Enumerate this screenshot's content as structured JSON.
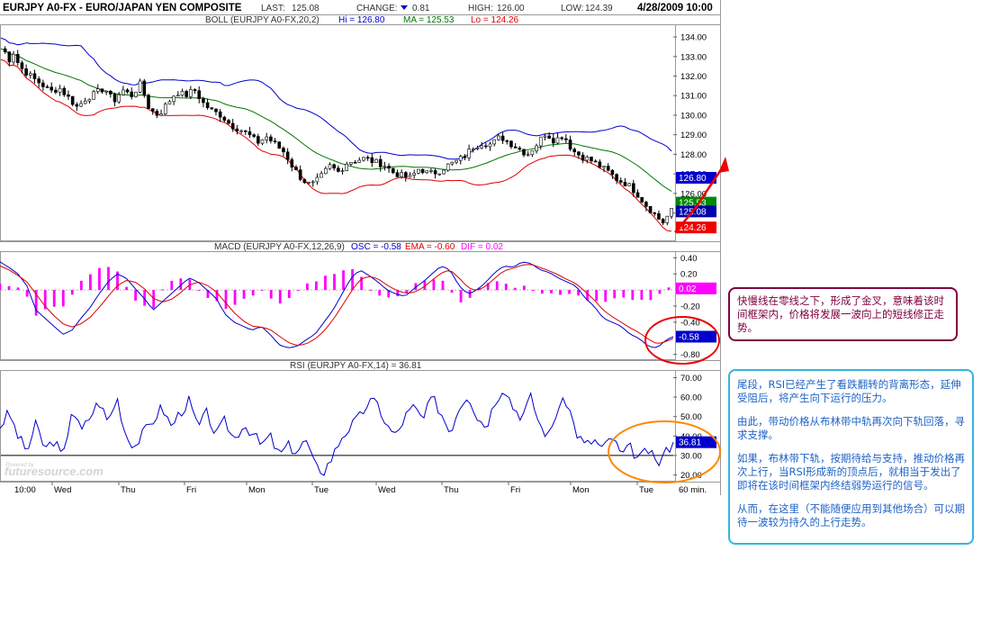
{
  "header": {
    "symbol": "EURJPY A0-FX - EURO/JAPAN YEN COMPOSITE",
    "last_label": "LAST:",
    "last_value": "125.08",
    "change_label": "CHANGE:",
    "change_value": "0.81",
    "high_label": "HIGH:",
    "high_value": "126.00",
    "low_label": "LOW:",
    "low_value": "124.39",
    "date_time": "4/28/2009 10:00"
  },
  "boll_legend": {
    "name": "BOLL (EURJPY A0-FX,20,2)",
    "hi": "Hi = 126.80",
    "ma": "MA = 125.53",
    "lo": "Lo = 124.26"
  },
  "macd_legend": {
    "name": "MACD (EURJPY A0-FX,12,26,9)",
    "osc": "OSC = -0.58",
    "ema": "EMA = -0.60",
    "dif": "DIF = 0.02"
  },
  "rsi_legend": {
    "name": "RSI (EURJPY A0-FX,14) = 36.81"
  },
  "watermark": "futuresource.com",
  "watermark_small": "Powered by",
  "colors": {
    "upper_band": "#0000cc",
    "middle_band": "#007700",
    "lower_band": "#dd0000",
    "macd_line": "#0000cc",
    "signal_line": "#dd0000",
    "histogram": "#ff00ff",
    "rsi_line": "#0000cc",
    "annotation_red": "#ee0000",
    "annotation_orange": "#ff8800",
    "callout_macd_border": "#800040",
    "callout_rsi_border": "#35b4e0",
    "callout_rsi_text": "#1f63c6"
  },
  "chart_data": [
    {
      "type": "line",
      "panel": "price",
      "ylim": [
        123.6,
        134.6
      ],
      "yticks": [
        "134.00",
        "133.00",
        "132.00",
        "131.00",
        "130.00",
        "129.00",
        "128.00",
        "127.00",
        "126.00",
        "125.00"
      ],
      "x_tick_labels": [
        "10:00",
        "Wed",
        "Thu",
        "Fri",
        "Mon",
        "Tue",
        "Wed",
        "Thu",
        "Fri",
        "Mon",
        "Tue",
        "60 min."
      ],
      "price_path_x": [
        0,
        5,
        10,
        15,
        20,
        28,
        35,
        45,
        55,
        65,
        75,
        85,
        95,
        105,
        115,
        125,
        135,
        145,
        155,
        165,
        175,
        185,
        195,
        205,
        215,
        225,
        235,
        245,
        255,
        265,
        275,
        285,
        295,
        305,
        315,
        325,
        335,
        345,
        355,
        365,
        375,
        385,
        395,
        405,
        415,
        425,
        435,
        445,
        455,
        465,
        475,
        485,
        495,
        505,
        515,
        525,
        535,
        545,
        555,
        565,
        575,
        585,
        595,
        605,
        615,
        625,
        635,
        645,
        655,
        665,
        675,
        685,
        695,
        705,
        715,
        725,
        735,
        745
      ],
      "price_path": [
        133.4,
        133.2,
        132.8,
        133.3,
        132.5,
        132.2,
        131.9,
        131.6,
        131.2,
        131.4,
        130.9,
        130.4,
        130.9,
        131.1,
        131.4,
        130.7,
        131.3,
        131.0,
        131.6,
        130.3,
        130.0,
        130.6,
        131.2,
        131.0,
        131.3,
        130.6,
        130.2,
        130.0,
        129.5,
        129.3,
        129.0,
        128.6,
        128.9,
        128.5,
        128.1,
        127.3,
        126.7,
        126.4,
        126.8,
        127.4,
        127.1,
        127.6,
        127.7,
        127.8,
        127.6,
        127.5,
        127.1,
        126.9,
        126.8,
        127.3,
        127.0,
        127.1,
        127.4,
        127.6,
        127.9,
        128.4,
        128.6,
        128.5,
        128.9,
        128.6,
        128.3,
        128.0,
        128.5,
        129.1,
        128.7,
        129.0,
        128.2,
        127.9,
        127.7,
        127.4,
        127.1,
        126.7,
        126.5,
        126.1,
        125.5,
        125.0,
        124.5,
        125.1
      ],
      "series": [
        {
          "name": "Hi",
          "last": 126.8
        },
        {
          "name": "MA",
          "last": 125.53
        },
        {
          "name": "Lo",
          "last": 124.26
        }
      ],
      "value_tags": [
        {
          "label": "126.80",
          "value": 126.8,
          "color": "#0000cc"
        },
        {
          "label": "125.53",
          "value": 125.53,
          "color": "#008800"
        },
        {
          "label": "125.08",
          "value": 125.08,
          "color": "#0000aa"
        },
        {
          "label": "124.26",
          "value": 124.26,
          "color": "#ee0000"
        }
      ]
    },
    {
      "type": "line",
      "panel": "macd",
      "ylim": [
        -0.86,
        0.46
      ],
      "yticks": [
        "0.40",
        "0.20",
        "-0.20",
        "-0.40",
        "-0.80"
      ],
      "macd_x": [
        0,
        10,
        20,
        30,
        40,
        50,
        60,
        70,
        80,
        90,
        100,
        110,
        120,
        130,
        140,
        150,
        160,
        170,
        180,
        190,
        200,
        210,
        220,
        230,
        240,
        250,
        260,
        270,
        280,
        290,
        300,
        310,
        320,
        330,
        340,
        350,
        360,
        370,
        380,
        390,
        400,
        410,
        420,
        430,
        440,
        450,
        460,
        470,
        480,
        490,
        500,
        510,
        520,
        530,
        540,
        550,
        560,
        570,
        580,
        590,
        600,
        610,
        620,
        630,
        640,
        650,
        660,
        670,
        680,
        690,
        700,
        710,
        720,
        730,
        740,
        748
      ],
      "macd": [
        0.35,
        0.28,
        0.2,
        0.05,
        -0.25,
        -0.35,
        -0.45,
        -0.55,
        -0.5,
        -0.35,
        -0.22,
        -0.05,
        0.1,
        0.2,
        0.15,
        0.02,
        -0.1,
        -0.25,
        -0.15,
        -0.05,
        0.05,
        0.15,
        0.1,
        0.0,
        -0.1,
        -0.3,
        -0.4,
        -0.45,
        -0.5,
        -0.45,
        -0.55,
        -0.68,
        -0.72,
        -0.7,
        -0.62,
        -0.55,
        -0.4,
        -0.25,
        -0.05,
        0.15,
        0.25,
        0.18,
        0.1,
        0.0,
        -0.05,
        -0.08,
        0.02,
        0.1,
        0.2,
        0.3,
        0.25,
        0.05,
        -0.05,
        0.0,
        0.1,
        0.22,
        0.3,
        0.28,
        0.35,
        0.33,
        0.25,
        0.22,
        0.15,
        0.1,
        0.05,
        -0.1,
        -0.2,
        -0.35,
        -0.4,
        -0.45,
        -0.55,
        -0.6,
        -0.7,
        -0.72,
        -0.62,
        -0.58
      ],
      "signal": [
        0.3,
        0.25,
        0.18,
        0.1,
        -0.05,
        -0.2,
        -0.32,
        -0.42,
        -0.46,
        -0.42,
        -0.34,
        -0.22,
        -0.08,
        0.05,
        0.12,
        0.1,
        0.02,
        -0.1,
        -0.15,
        -0.12,
        -0.04,
        0.06,
        0.1,
        0.06,
        -0.02,
        -0.15,
        -0.28,
        -0.38,
        -0.45,
        -0.46,
        -0.49,
        -0.57,
        -0.65,
        -0.69,
        -0.67,
        -0.61,
        -0.51,
        -0.37,
        -0.2,
        -0.02,
        0.13,
        0.17,
        0.14,
        0.06,
        0.0,
        -0.04,
        -0.03,
        0.03,
        0.12,
        0.21,
        0.25,
        0.15,
        0.03,
        -0.01,
        0.05,
        0.15,
        0.24,
        0.27,
        0.31,
        0.32,
        0.28,
        0.24,
        0.19,
        0.13,
        0.08,
        -0.02,
        -0.12,
        -0.25,
        -0.33,
        -0.4,
        -0.47,
        -0.53,
        -0.61,
        -0.67,
        -0.64,
        -0.6
      ],
      "series": [
        {
          "name": "OSC",
          "last": -0.58
        },
        {
          "name": "EMA",
          "last": -0.6
        },
        {
          "name": "DIF",
          "last": 0.02
        }
      ],
      "value_tags": [
        {
          "label": "0.02",
          "value": 0.02,
          "color": "#ff00ff"
        },
        {
          "label": "-0.58",
          "value": -0.58,
          "color": "#0000cc"
        }
      ]
    },
    {
      "type": "line",
      "panel": "rsi",
      "ylim": [
        17,
        73
      ],
      "yticks": [
        "70.00",
        "60.00",
        "50.00",
        "40.00",
        "30.00",
        "20.00"
      ],
      "reference_line": 30,
      "rsi_x": [
        0,
        10,
        20,
        30,
        40,
        50,
        60,
        70,
        80,
        90,
        100,
        110,
        120,
        130,
        140,
        150,
        160,
        170,
        180,
        190,
        200,
        210,
        220,
        230,
        240,
        250,
        260,
        270,
        280,
        290,
        300,
        310,
        320,
        330,
        340,
        350,
        360,
        370,
        380,
        390,
        400,
        410,
        420,
        430,
        440,
        450,
        460,
        470,
        480,
        490,
        500,
        510,
        520,
        530,
        540,
        550,
        560,
        570,
        580,
        590,
        600,
        610,
        620,
        630,
        640,
        650,
        660,
        670,
        680,
        690,
        700,
        710,
        720,
        730,
        740,
        748
      ],
      "rsi": [
        45,
        52,
        40,
        32,
        46,
        33,
        38,
        28,
        55,
        42,
        50,
        58,
        47,
        60,
        40,
        35,
        42,
        48,
        55,
        45,
        52,
        58,
        44,
        52,
        40,
        48,
        38,
        46,
        42,
        35,
        40,
        30,
        35,
        32,
        38,
        24,
        22,
        30,
        40,
        45,
        50,
        58,
        56,
        45,
        40,
        50,
        55,
        48,
        60,
        52,
        42,
        55,
        62,
        50,
        45,
        58,
        66,
        55,
        50,
        60,
        45,
        40,
        55,
        58,
        42,
        35,
        38,
        33,
        40,
        30,
        34,
        28,
        33,
        25,
        32,
        36.81
      ],
      "value_tags": [
        {
          "label": "36.81",
          "value": 36.81,
          "color": "#0000cc"
        }
      ]
    }
  ],
  "annotations": {
    "macd_callout": "快慢线在零线之下，形成了金叉，意味着该时间框架内，价格将发展一波向上的短线修正走势。",
    "rsi_callout_p1": "尾段，RSI已经产生了看跌翻转的背离形态，延伸受阻后，将产生向下运行的压力。",
    "rsi_callout_p2": "由此，带动价格从布林带中轨再次向下轨回落，寻求支撑。",
    "rsi_callout_p3": "如果，布林带下轨，按期待给与支持，推动价格再次上行，当RSI形成新的顶点后，就相当于发出了即将在该时间框架内终结弱势运行的信号。",
    "rsi_callout_p4": "从而，在这里（不能随便应用到其他场合）可以期待一波较为持久的上行走势。"
  }
}
